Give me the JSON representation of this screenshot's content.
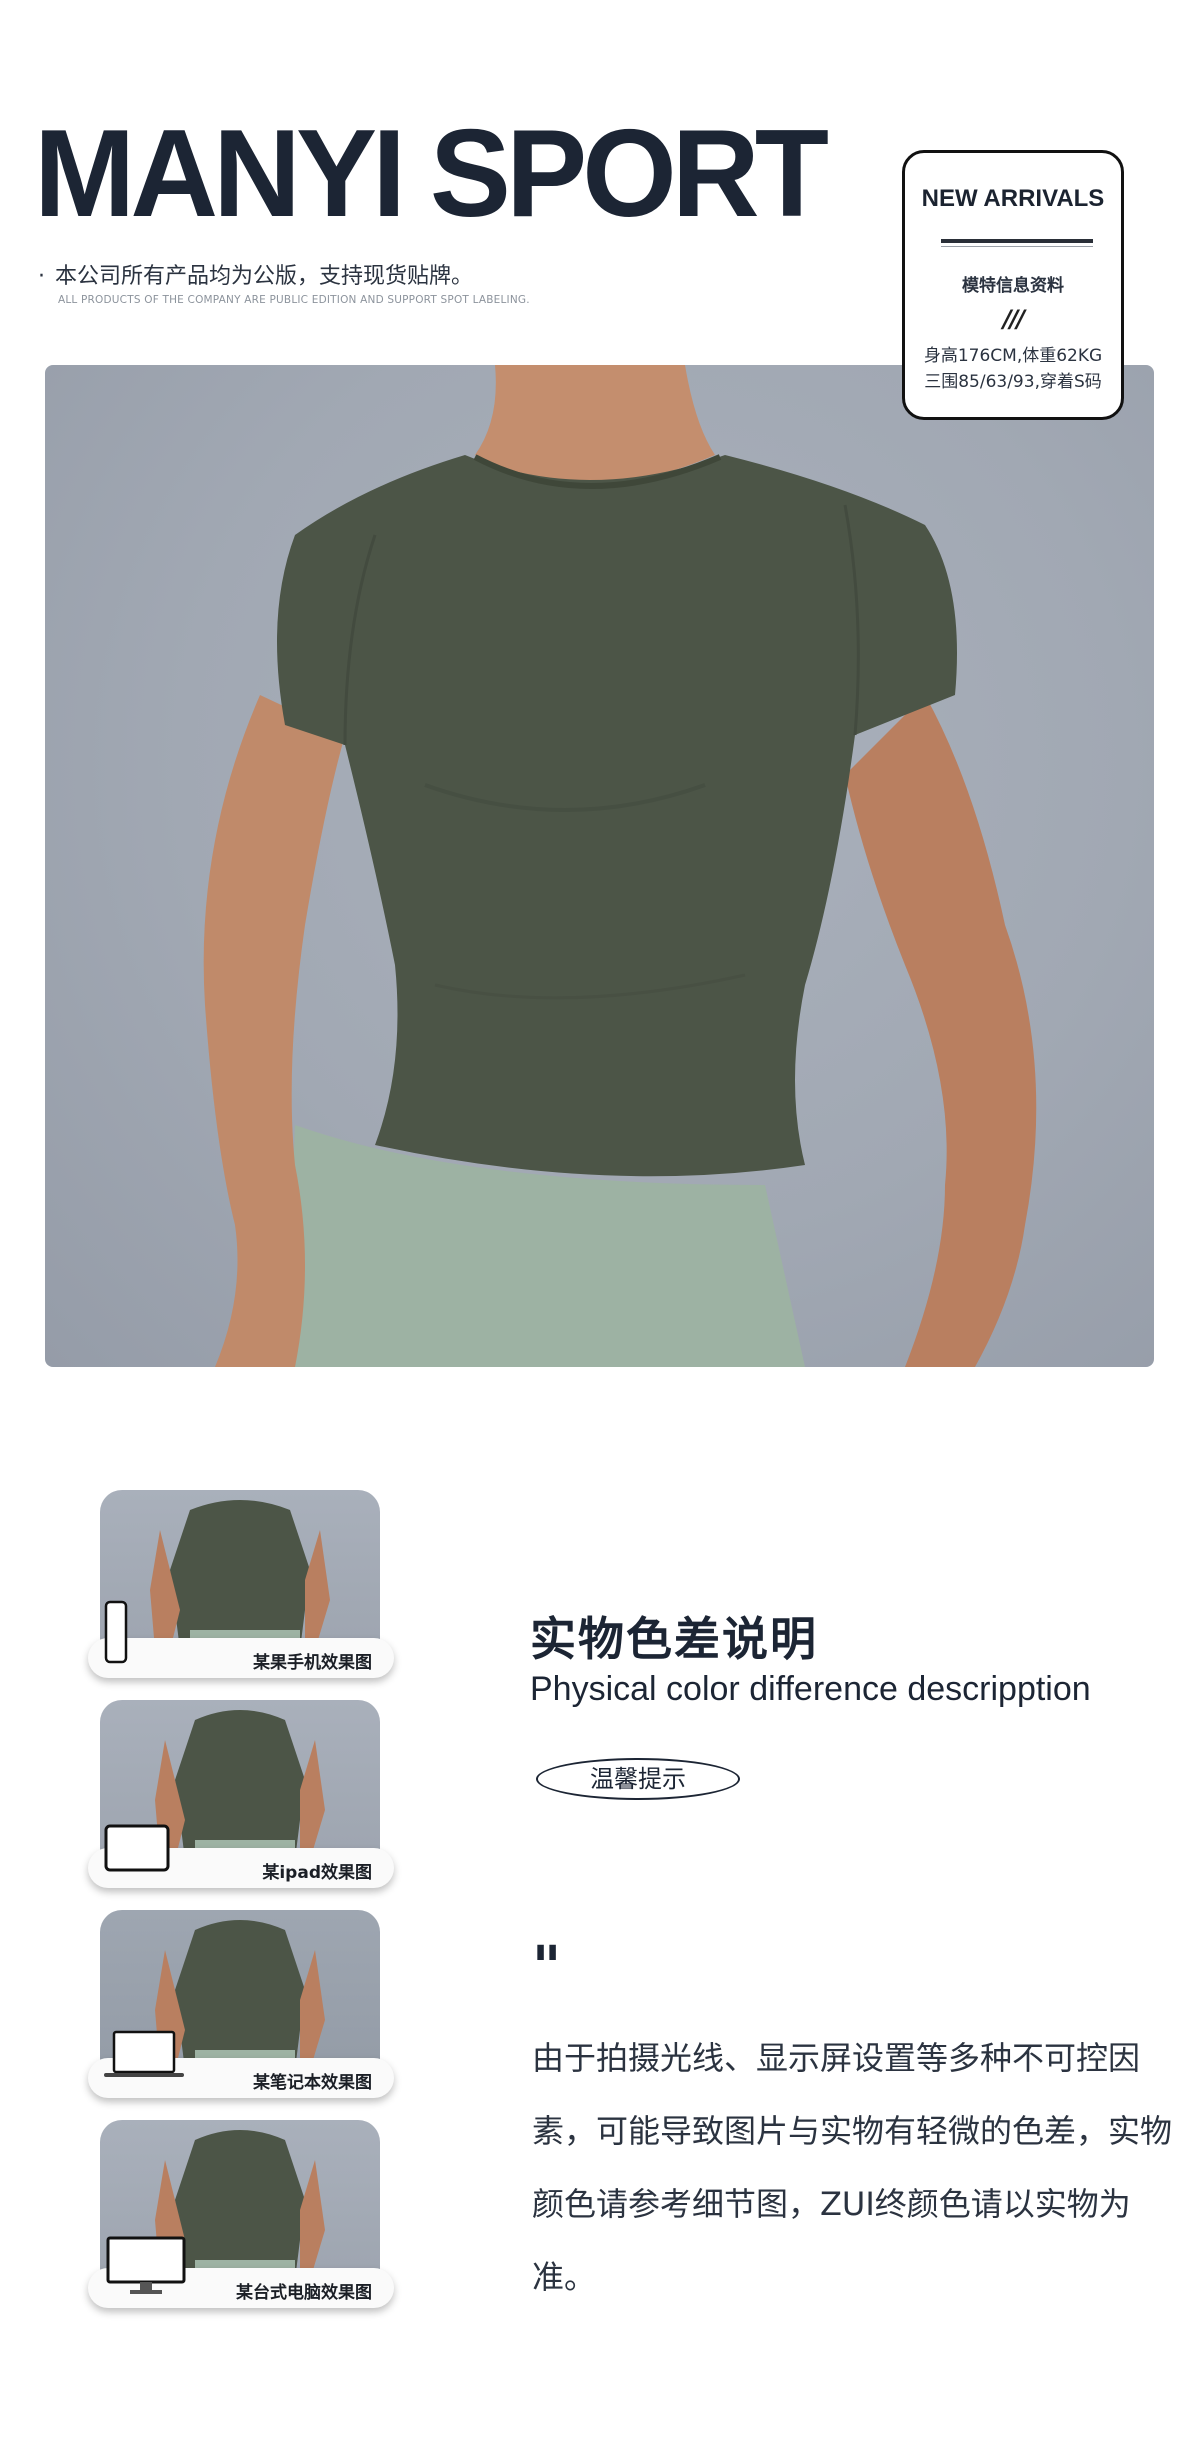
{
  "header": {
    "brand": "MANYI SPORT",
    "notice_cn": "本公司所有产品均为公版，支持现货贴牌。",
    "notice_en": "ALL PRODUCTS OF THE COMPANY ARE PUBLIC EDITION AND SUPPORT SPOT LABELING."
  },
  "model_card": {
    "title": "NEW ARRIVALS",
    "info_label": "模特信息资料",
    "divider_glyph": "///",
    "line_1": "身高176CM,体重62KG",
    "line_2": "三围85/63/93,穿着S码"
  },
  "product": {
    "shirt_color": "#4c5547",
    "legging_color": "#9db2a3",
    "backdrop_color": "#a4abb6"
  },
  "previews": [
    {
      "label": "某果手机效果图",
      "device": "phone-icon"
    },
    {
      "label": "某ipad效果图",
      "device": "tablet-icon"
    },
    {
      "label": "某笔记本效果图",
      "device": "laptop-icon"
    },
    {
      "label": "某台式电脑效果图",
      "device": "desktop-monitor-icon"
    }
  ],
  "color_note": {
    "title": "实物色差说明",
    "subtitle": "Physical color difference descripption",
    "tip": "温馨提示",
    "quote": "\"",
    "body": "由于拍摄光线、显示屏设置等多种不可控因素，可能导致图片与实物有轻微的色差，实物颜色请参考细节图，ZUI终颜色请以实物为准。"
  }
}
